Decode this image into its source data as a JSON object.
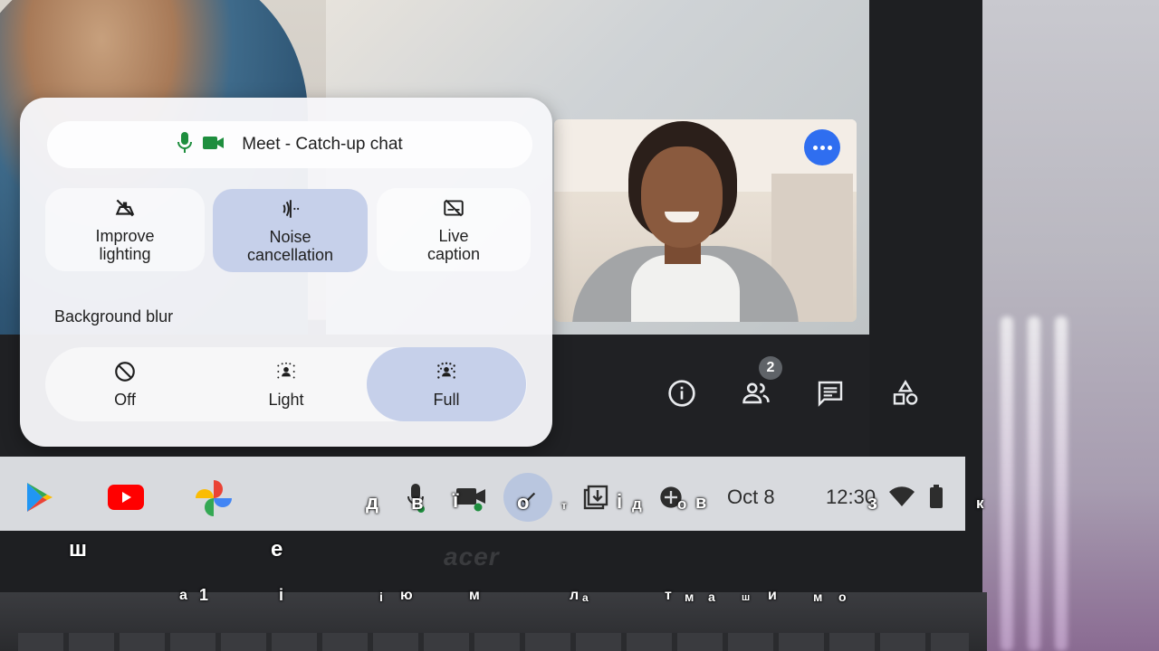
{
  "meet_panel": {
    "app_title": "Meet - Catch-up chat",
    "tiles": [
      {
        "label_line1": "Improve",
        "label_line2": "lighting",
        "active": false,
        "icon": "lighting-off-icon"
      },
      {
        "label_line1": "Noise",
        "label_line2": "cancellation",
        "active": true,
        "icon": "noise-cancellation-icon"
      },
      {
        "label_line1": "Live",
        "label_line2": "caption",
        "active": false,
        "icon": "caption-off-icon"
      }
    ],
    "background_blur": {
      "label": "Background blur",
      "options": [
        {
          "label": "Off",
          "icon": "block-icon",
          "selected": false
        },
        {
          "label": "Light",
          "icon": "person-blur-light-icon",
          "selected": false
        },
        {
          "label": "Full",
          "icon": "person-blur-full-icon",
          "selected": true
        }
      ]
    }
  },
  "meet_controls": {
    "participant_count": "2",
    "icons": [
      "info-icon",
      "people-icon",
      "chat-icon",
      "activities-icon"
    ]
  },
  "shelf": {
    "apps": [
      "play-store-icon",
      "youtube-icon",
      "photos-icon"
    ],
    "date": "Oct 8",
    "time": "12:30"
  },
  "brand": "acer",
  "colors": {
    "accent_blue": "#2f6ef0",
    "selected_tile": "#c6d0ea",
    "panel_bg": "#f6f6f9",
    "meet_green": "#1e8e3e"
  },
  "caption_overlay": {
    "row1": [
      "д",
      "в",
      "ї",
      "о",
      "т",
      "і",
      "д",
      "о",
      "в",
      "з",
      "к"
    ],
    "row2": [
      "ш",
      "е"
    ],
    "row3": [
      "а",
      "1",
      "і",
      "і",
      "ю",
      "м",
      "л",
      "а",
      "т",
      "м",
      "а",
      "ш",
      "и",
      "м",
      "о"
    ]
  }
}
